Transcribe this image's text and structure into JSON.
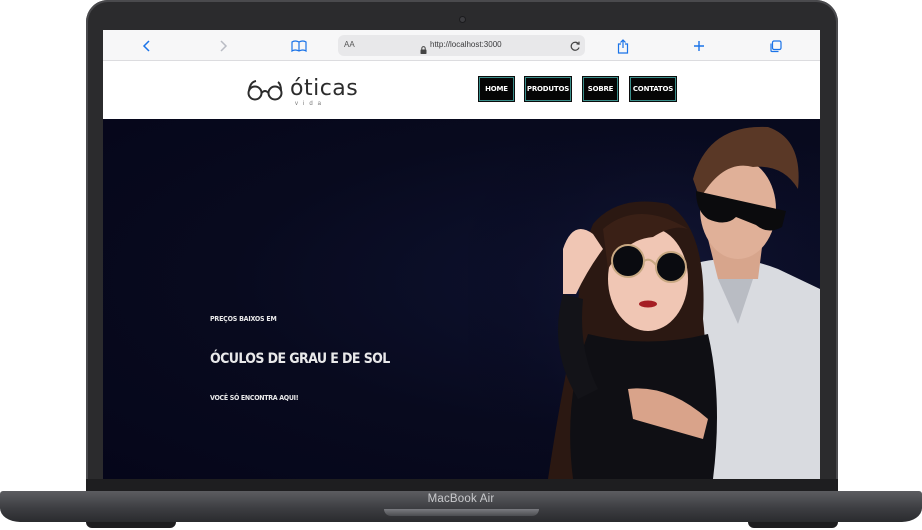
{
  "device": {
    "label": "MacBook Air"
  },
  "browser": {
    "reader_label": "AA",
    "url": "http://localhost:3000"
  },
  "site": {
    "brand": "óticas",
    "brand_sub": "vida",
    "nav": [
      "HOME",
      "PRODUTOS",
      "SOBRE",
      "CONTATOS"
    ]
  },
  "hero": {
    "kicker": "PREÇOS BAIXOS EM",
    "headline": "ÓCULOS DE GRAU E DE SOL",
    "tagline": "VOCÊ SÓ ENCONTRA AQUI!",
    "image": "couple-wearing-sunglasses-photo"
  },
  "icons": [
    "back-icon",
    "forward-icon",
    "bookmarks-icon",
    "lock-icon",
    "reload-icon",
    "share-icon",
    "new-tab-icon",
    "tabs-icon",
    "glasses-logo-icon"
  ],
  "colors": {
    "nav_bg": "#050505",
    "nav_border": "#3a8e8a",
    "hero_bg": "#080a1e",
    "accent": "#1a73e8"
  }
}
